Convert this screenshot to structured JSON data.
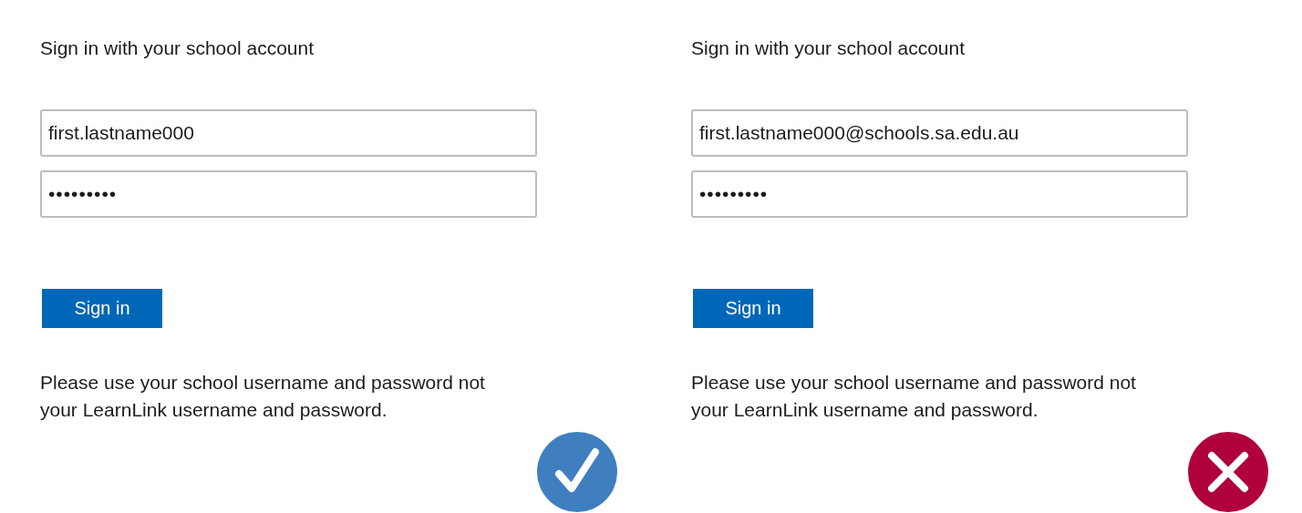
{
  "panels": [
    {
      "title": "Sign in with your school account",
      "username": "first.lastname000",
      "password": "•••••••••",
      "button": "Sign in",
      "note": "Please use your school username and password not your LearnLink username and password.",
      "verdict": {
        "kind": "correct"
      }
    },
    {
      "title": "Sign in with your school account",
      "username": "first.lastname000@schools.sa.edu.au",
      "password": "•••••••••",
      "button": "Sign in",
      "note": "Please use your school username and password not your LearnLink username and password.",
      "verdict": {
        "kind": "incorrect"
      }
    }
  ]
}
